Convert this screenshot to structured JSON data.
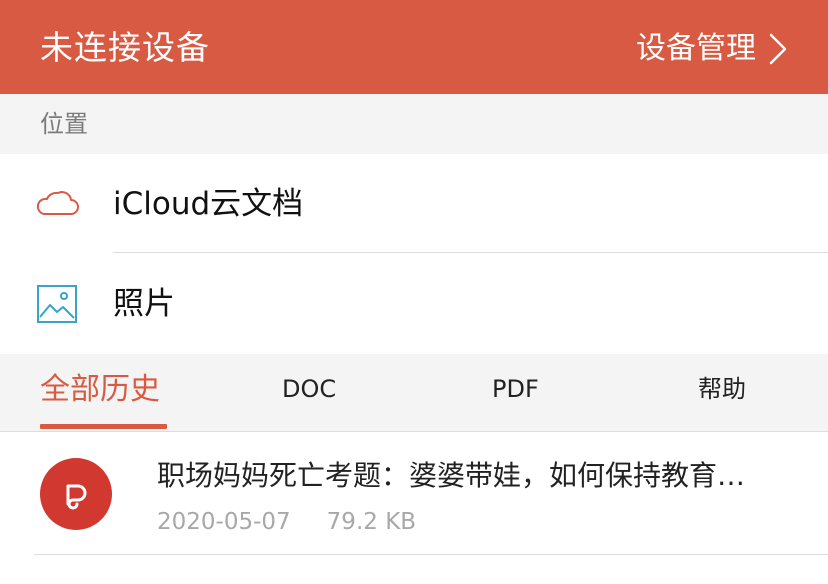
{
  "header": {
    "title": "未连接设备",
    "manage_label": "设备管理",
    "accent": "#D95A42",
    "chevron_icon": "chevron-right-icon"
  },
  "location": {
    "section_label": "位置",
    "items": [
      {
        "label": "iCloud云文档",
        "icon": "cloud-icon"
      },
      {
        "label": "照片",
        "icon": "photo-icon"
      }
    ]
  },
  "tabs": [
    {
      "label": "全部历史",
      "active": true
    },
    {
      "label": "DOC",
      "active": false
    },
    {
      "label": "PDF",
      "active": false
    },
    {
      "label": "帮助",
      "active": false
    }
  ],
  "files": [
    {
      "title": "职场妈妈死亡考题：婆婆带娃，如何保持教育…",
      "date": "2020-05-07",
      "size": "79.2 KB",
      "icon": "pdf-app-icon",
      "icon_color": "#D1382F"
    }
  ]
}
